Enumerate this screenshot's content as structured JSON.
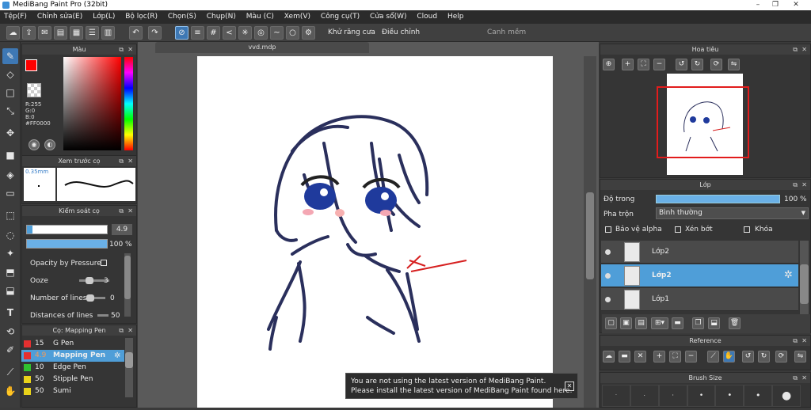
{
  "window": {
    "title": "MediBang Paint Pro (32bit)"
  },
  "menu": [
    "Tệp(F)",
    "Chỉnh sửa(E)",
    "Lớp(L)",
    "Bộ lọc(R)",
    "Chọn(S)",
    "Chụp(N)",
    "Màu (C)",
    "Xem(V)",
    "Công cụ(T)",
    "Cửa sổ(W)",
    "Cloud",
    "Help"
  ],
  "toolbar": {
    "antialias_label": "Khử răng cưa",
    "adjust_label": "Điều chỉnh",
    "adjust_value": "0",
    "smooth_label": "Canh mềm"
  },
  "color_panel": {
    "title": "Màu",
    "r": "R:255",
    "g": "G:0",
    "b": "B:0",
    "hex": "#FF0000",
    "primary_color": "#ff0000",
    "secondary_color": "#1a6fd0"
  },
  "brush_preview": {
    "title": "Xem trước cọ",
    "size": "0.35mm"
  },
  "brush_control": {
    "title": "Kiểm soát cọ",
    "size_value": "4.9",
    "opacity_value": "100 %",
    "opacity_pressure_label": "Opacity by Pressure",
    "ooze_label": "Ooze",
    "ooze_value": "3",
    "lines_label": "Number of lines",
    "lines_value": "0",
    "distance_label": "Distances of lines",
    "distance_value": "50"
  },
  "brush_list": {
    "title": "Cọ: Mapping Pen",
    "items": [
      {
        "size": "15",
        "name": "G Pen",
        "color": "#e53030"
      },
      {
        "size": "4.9",
        "name": "Mapping Pen",
        "color": "#e53030"
      },
      {
        "size": "10",
        "name": "Edge Pen",
        "color": "#2fc12f"
      },
      {
        "size": "50",
        "name": "Stipple Pen",
        "color": "#e8d21a"
      },
      {
        "size": "50",
        "name": "Sumi",
        "color": "#e8d21a"
      }
    ]
  },
  "document": {
    "tab": "vvd.mdp"
  },
  "navigator": {
    "title": "Hoa tiêu"
  },
  "layer_panel": {
    "title": "Lớp",
    "opacity_label": "Độ trong",
    "opacity_value": "100 %",
    "blend_label": "Pha trộn",
    "blend_value": "Bình thường",
    "protect_alpha": "Bảo vệ alpha",
    "clip": "Xén bớt",
    "lock": "Khóa",
    "layers": [
      {
        "name": "Lớp2"
      },
      {
        "name": "Lớp2"
      },
      {
        "name": "Lớp1"
      }
    ]
  },
  "reference_panel": {
    "title": "Reference"
  },
  "brush_size_panel": {
    "title": "Brush Size"
  },
  "notification": {
    "line1": "You are not using the latest version of MediBang Paint.",
    "line2": "Please install the latest version of MediBang Paint found here."
  }
}
